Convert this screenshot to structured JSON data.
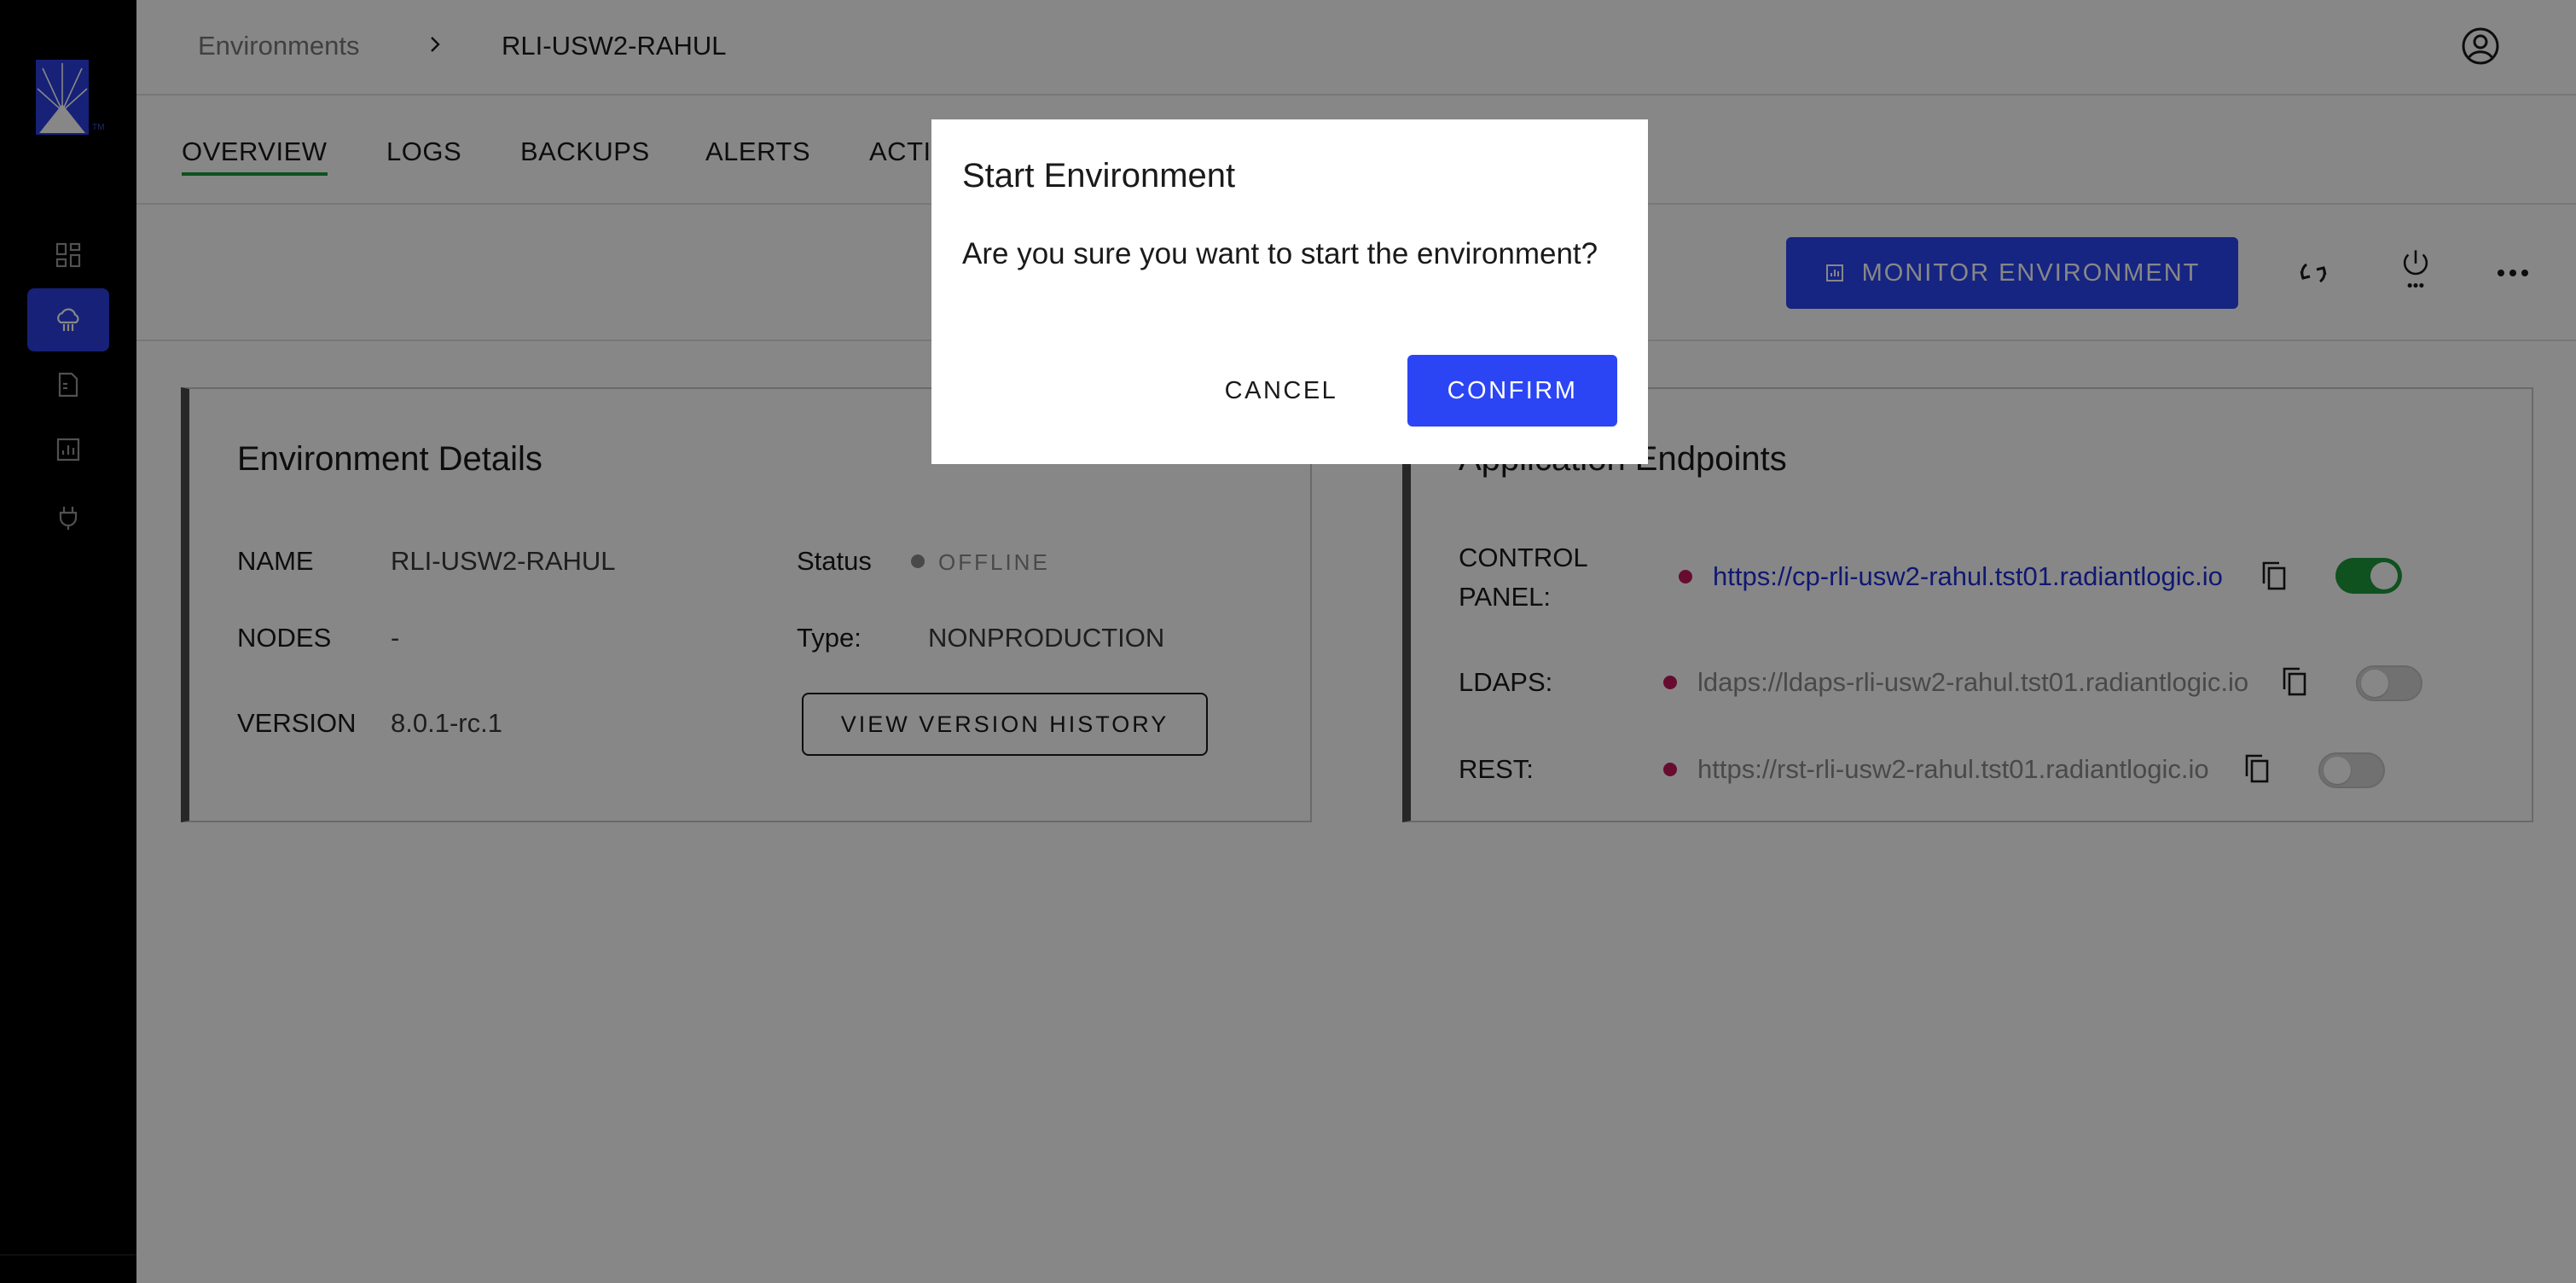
{
  "breadcrumb": {
    "root": "Environments",
    "current": "RLI-USW2-RAHUL"
  },
  "tabs": [
    {
      "label": "OVERVIEW",
      "active": true
    },
    {
      "label": "LOGS"
    },
    {
      "label": "BACKUPS"
    },
    {
      "label": "ALERTS"
    },
    {
      "label": "ACTIVITY"
    }
  ],
  "sidebar": {
    "logo_tm": "TM",
    "items": [
      {
        "icon": "dashboard-icon"
      },
      {
        "icon": "cloud-environments-icon",
        "active": true
      },
      {
        "icon": "document-icon"
      },
      {
        "icon": "reports-icon"
      },
      {
        "icon": "plug-icon"
      }
    ]
  },
  "actions": {
    "monitor_label": "MONITOR ENVIRONMENT"
  },
  "details": {
    "title": "Environment Details",
    "name_label": "NAME",
    "name_value": "RLI-USW2-RAHUL",
    "nodes_label": "NODES",
    "nodes_value": "-",
    "version_label": "VERSION",
    "version_value": "8.0.1-rc.1",
    "status_label": "Status",
    "status_value": "OFFLINE",
    "type_label": "Type:",
    "type_value": "NONPRODUCTION",
    "history_button": "VIEW VERSION HISTORY"
  },
  "endpoints": {
    "title": "Application Endpoints",
    "control_panel_label_1": "CONTROL",
    "control_panel_label_2": "PANEL:",
    "control_panel_url": "https://cp-rli-usw2-rahul.tst01.radiantlogic.io",
    "control_panel_enabled": true,
    "ldaps_label": "LDAPS:",
    "ldaps_url": "ldaps://ldaps-rli-usw2-rahul.tst01.radiantlogic.io",
    "ldaps_enabled": false,
    "rest_label": "REST:",
    "rest_url": "https://rst-rli-usw2-rahul.tst01.radiantlogic.io",
    "rest_enabled": false
  },
  "dialog": {
    "title": "Start Environment",
    "message": "Are you sure you want to start the environment?",
    "cancel": "CANCEL",
    "confirm": "CONFIRM"
  },
  "colors": {
    "accent": "#2b45f5",
    "tab_indicator": "#1e9a3c",
    "toggle_on": "#1e9a3c",
    "endpoint_dot": "#c2185b",
    "status_offline": "#8a8a8a"
  }
}
